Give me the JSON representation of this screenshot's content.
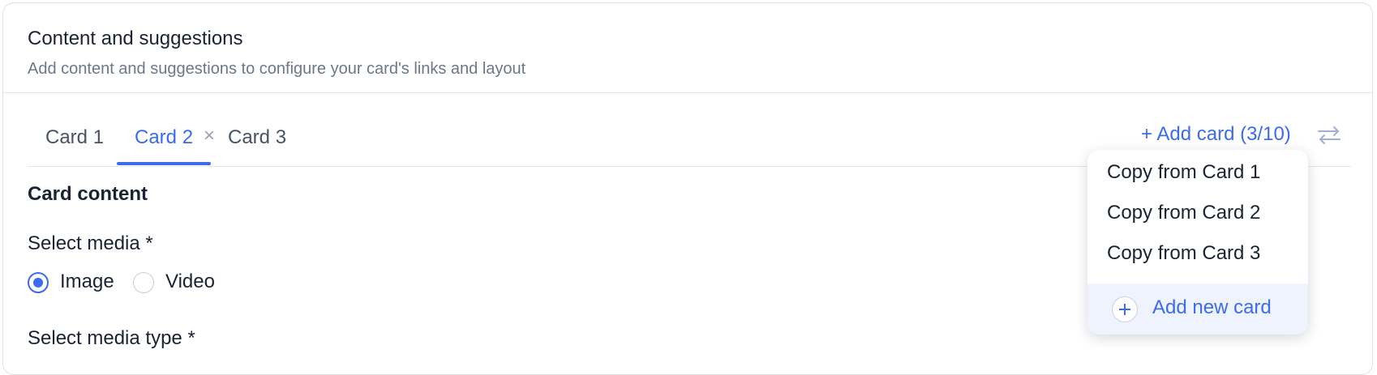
{
  "header": {
    "title": "Content and suggestions",
    "subtitle": "Add content and suggestions to configure your card's links and layout"
  },
  "tabs": [
    {
      "label": "Card 1",
      "active": false
    },
    {
      "label": "Card 2",
      "active": true
    },
    {
      "label": "Card 3",
      "active": false
    }
  ],
  "tab_close_glyph": "×",
  "add_card_label": "+ Add card (3/10)",
  "swap_icon": "swap-arrows-icon",
  "section": {
    "title": "Card content",
    "select_media_label": "Select media *",
    "media_options": [
      {
        "label": "Image",
        "selected": true
      },
      {
        "label": "Video",
        "selected": false
      }
    ],
    "select_media_type_label": "Select media type *"
  },
  "dropdown": {
    "items": [
      "Copy from Card 1",
      "Copy from Card 2",
      "Copy from Card 3"
    ],
    "add_new_label": "Add new card"
  },
  "colors": {
    "accent": "#3b6bee",
    "text": "#1b2333",
    "muted": "#6e7788",
    "border": "#dde1e8",
    "menu_highlight": "#eef3fd"
  }
}
